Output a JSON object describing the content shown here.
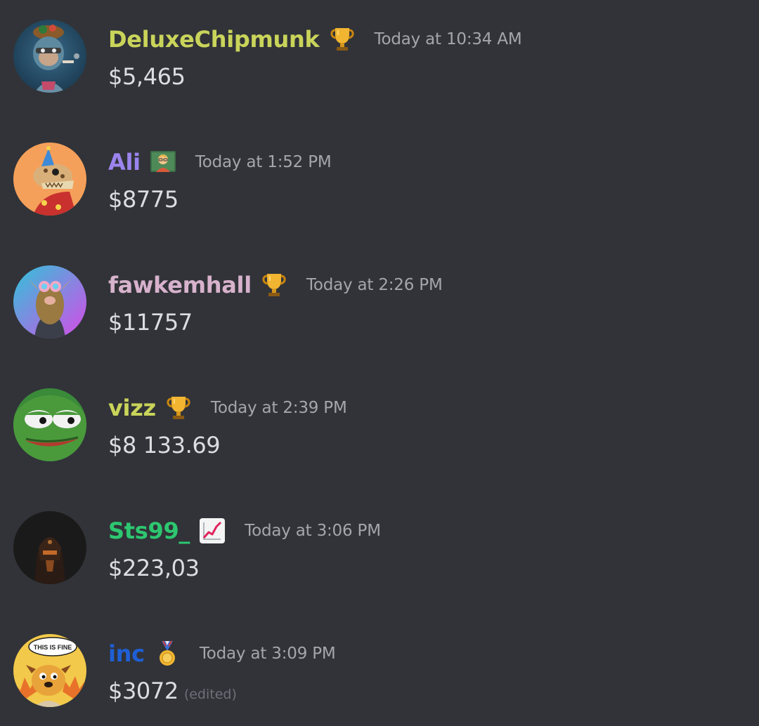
{
  "colors": {
    "background": "#313338",
    "timestamp": "#a3a6ab",
    "message_text": "#dbdee1",
    "edited": "#6d7079"
  },
  "messages": [
    {
      "username": "DeluxeChipmunk",
      "username_color": "#c9d45a",
      "badge_icon": "trophy-icon",
      "timestamp": "Today at 10:34 AM",
      "content": "$5,465",
      "edited_label": "",
      "avatar": "ape-avatar"
    },
    {
      "username": "Ali",
      "username_color": "#9b84ee",
      "badge_icon": "teacher-icon",
      "timestamp": "Today at 1:52 PM",
      "content": "$8775",
      "edited_label": "",
      "avatar": "dinosaur-avatar"
    },
    {
      "username": "fawkemhall",
      "username_color": "#d7b2cc",
      "badge_icon": "trophy-icon",
      "timestamp": "Today at 2:26 PM",
      "content": "$11757",
      "edited_label": "",
      "avatar": "llama-avatar"
    },
    {
      "username": "vizz",
      "username_color": "#c9d45a",
      "badge_icon": "trophy-icon",
      "timestamp": "Today at 2:39 PM",
      "content": "$8 133.69",
      "edited_label": "",
      "avatar": "pepe-frog-avatar"
    },
    {
      "username": "Sts99_",
      "username_color": "#2dc770",
      "badge_icon": "chart-increasing-icon",
      "timestamp": "Today at 3:06 PM",
      "content": "$223,03",
      "edited_label": "",
      "avatar": "dark-helmet-avatar"
    },
    {
      "username": "inc",
      "username_color": "#1f5fd6",
      "badge_icon": "medal-icon",
      "timestamp": "Today at 3:09 PM",
      "content": "$3072",
      "edited_label": "(edited)",
      "avatar": "this-is-fine-dog-avatar",
      "avatar_text": "THIS IS FINE"
    }
  ]
}
